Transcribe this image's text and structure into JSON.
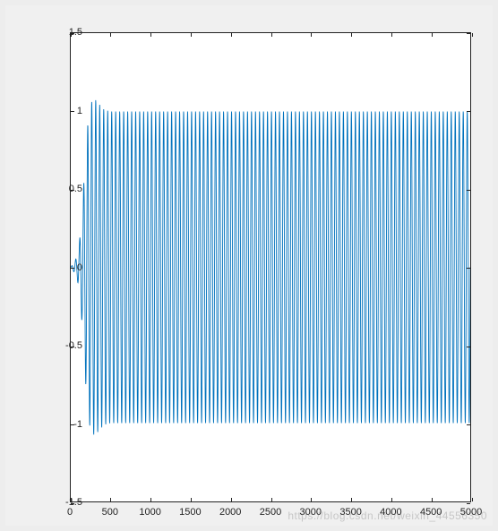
{
  "chart_data": {
    "type": "line",
    "series_color": "#0072bd",
    "xlim": [
      0,
      5000
    ],
    "ylim": [
      -1.5,
      1.5
    ],
    "x_ticks": [
      0,
      500,
      1000,
      1500,
      2000,
      2500,
      3000,
      3500,
      4000,
      4500,
      5000
    ],
    "y_ticks": [
      -1.5,
      -1,
      -0.5,
      0,
      0.5,
      1,
      1.5
    ],
    "description": "Transient oscillation growing from ~0 amplitude to steady-state sinusoid of amplitude ≈1 after ~x=400 with slight overshoot ≈1.08",
    "envelope_points": [
      {
        "x": 0,
        "amp": 0.0
      },
      {
        "x": 40,
        "amp": 0.03
      },
      {
        "x": 80,
        "amp": 0.07
      },
      {
        "x": 110,
        "amp": 0.17
      },
      {
        "x": 140,
        "amp": 0.35
      },
      {
        "x": 170,
        "amp": 0.6
      },
      {
        "x": 200,
        "amp": 0.85
      },
      {
        "x": 230,
        "amp": 1.0
      },
      {
        "x": 260,
        "amp": 1.06
      },
      {
        "x": 300,
        "amp": 1.08
      },
      {
        "x": 350,
        "amp": 1.05
      },
      {
        "x": 420,
        "amp": 1.01
      },
      {
        "x": 500,
        "amp": 1.0
      },
      {
        "x": 5000,
        "amp": 1.0
      }
    ],
    "oscillation_period": 50,
    "steady_state_amplitude": 1.0,
    "overshoot_amplitude": 1.08,
    "title": "",
    "xlabel": "",
    "ylabel": ""
  },
  "labels": {
    "y": {
      "n15": "-1.5",
      "n10": "-1",
      "n05": "-0.5",
      "z": "0",
      "p05": "0.5",
      "p10": "1",
      "p15": "1.5"
    },
    "x": {
      "t0": "0",
      "t500": "500",
      "t1000": "1000",
      "t1500": "1500",
      "t2000": "2000",
      "t2500": "2500",
      "t3000": "3000",
      "t3500": "3500",
      "t4000": "4000",
      "t4500": "4500",
      "t5000": "5000"
    }
  },
  "watermark": "https://blog.csdn.net/weixin_44556350"
}
